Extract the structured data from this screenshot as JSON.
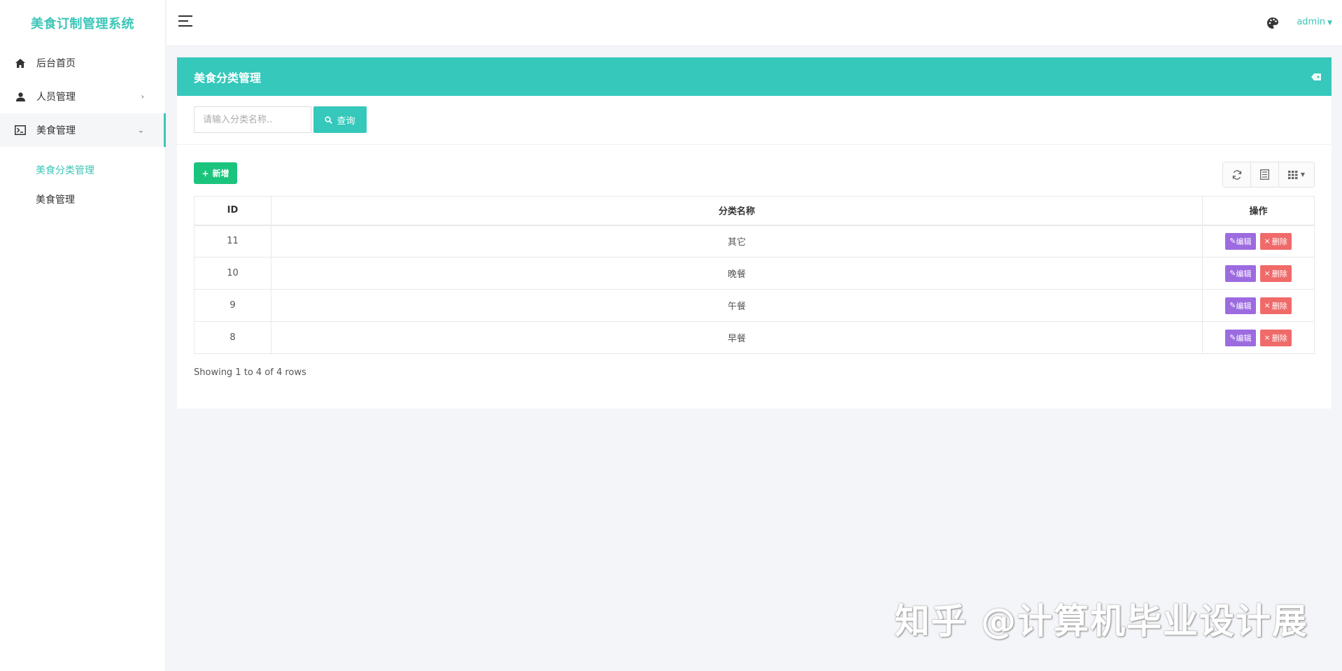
{
  "app": {
    "title": "美食订制管理系统"
  },
  "sidebar": {
    "items": [
      {
        "label": "后台首页",
        "icon": "home-icon"
      },
      {
        "label": "人员管理",
        "icon": "user-icon",
        "caret": "›"
      },
      {
        "label": "美食管理",
        "icon": "terminal-icon",
        "caret": "⌄"
      }
    ],
    "submenu": [
      {
        "label": "美食分类管理",
        "active": true
      },
      {
        "label": "美食管理",
        "active": false
      }
    ]
  },
  "topbar": {
    "user": "admin"
  },
  "panel": {
    "title": "美食分类管理",
    "search_placeholder": "请输入分类名称..",
    "search_button": "查询",
    "add_button": "新增",
    "columns": [
      "ID",
      "分类名称",
      "操作"
    ],
    "rows": [
      {
        "id": "11",
        "name": "其它"
      },
      {
        "id": "10",
        "name": "晚餐"
      },
      {
        "id": "9",
        "name": "午餐"
      },
      {
        "id": "8",
        "name": "早餐"
      }
    ],
    "edit_label": "编辑",
    "delete_label": "删除",
    "pager_info": "Showing 1 to 4 of 4 rows"
  },
  "watermark": "知乎 @计算机毕业设计展",
  "colors": {
    "accent": "#35c8bb",
    "add": "#1bc47d",
    "edit": "#9c6be0",
    "delete": "#f06a6a"
  }
}
